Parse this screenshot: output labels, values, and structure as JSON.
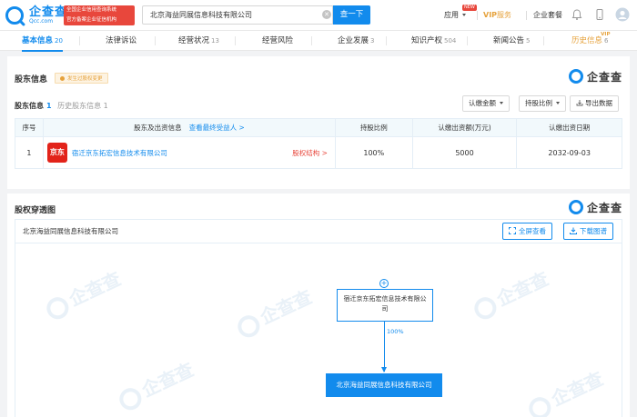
{
  "header": {
    "logo_cn": "企查查",
    "logo_en": "Qcc.com",
    "cert_line1": "全国企业信用查询系统",
    "cert_line2": "官方备案企业征信机构",
    "search_value": "北京海益同展信息科技有限公司",
    "search_button": "查一下",
    "apps_label": "应用",
    "apps_badge": "NEW",
    "vip_label": "VIP",
    "vip_service": "服务",
    "package_label": "企业套餐"
  },
  "tabs": [
    {
      "label": "基本信息",
      "count": "20"
    },
    {
      "label": "法律诉讼",
      "count": ""
    },
    {
      "label": "经营状况",
      "count": "13"
    },
    {
      "label": "经营风险",
      "count": ""
    },
    {
      "label": "企业发展",
      "count": "3"
    },
    {
      "label": "知识产权",
      "count": "504"
    },
    {
      "label": "新闻公告",
      "count": "5"
    },
    {
      "label": "历史信息",
      "count": "6",
      "badge": "VIP"
    }
  ],
  "shareholders": {
    "title": "股东信息",
    "warning_tag": "发生过股权变更",
    "brand": "企查查",
    "subtab_active": "股东信息",
    "subtab_active_count": "1",
    "subtab_history": "历史股东信息 1",
    "btn_subscribed": "认缴金额",
    "btn_ratio": "持股比例",
    "btn_export": "导出数据",
    "columns": {
      "no": "序号",
      "name": "股东及出资信息",
      "find_beneficiary": "查看最终受益人 >",
      "ratio": "持股比例",
      "subscribed": "认缴出资额(万元)",
      "date": "认缴出资日期"
    },
    "rows": [
      {
        "no": "1",
        "logo_text": "京东",
        "name": "宿迁京东拓宏信息技术有限公司",
        "equity_link": "股权结构 >",
        "ratio": "100%",
        "subscribed": "5000",
        "date": "2032-09-03"
      }
    ]
  },
  "equity_chart": {
    "title": "股权穿透图",
    "brand": "企查查",
    "company": "北京海益同展信息科技有限公司",
    "btn_fullscreen": "全屏查看",
    "btn_download": "下载图谱",
    "watermark": "企查查",
    "parent_node": "宿迁京东拓宏信息技术有限公司",
    "edge_percent": "100%",
    "target_node": "北京海益同展信息科技有限公司"
  }
}
